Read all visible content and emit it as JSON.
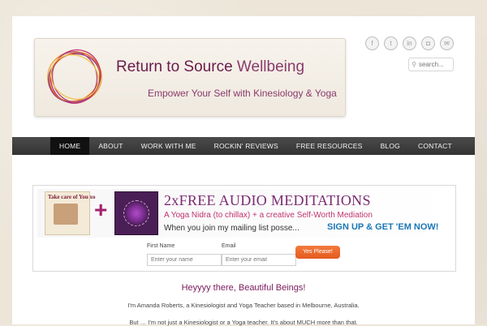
{
  "header": {
    "title_bold": "Return to Source",
    "title_light": "Wellbeing",
    "tagline": "Empower Your Self with Kinesiology & Yoga"
  },
  "social": {
    "icons": [
      {
        "name": "facebook-icon",
        "glyph": "f"
      },
      {
        "name": "twitter-icon",
        "glyph": "t"
      },
      {
        "name": "linkedin-icon",
        "glyph": "in"
      },
      {
        "name": "instagram-icon",
        "glyph": "◘"
      },
      {
        "name": "email-icon",
        "glyph": "✉"
      }
    ]
  },
  "search": {
    "placeholder": "search..."
  },
  "nav": {
    "items": [
      {
        "label": "HOME",
        "active": true
      },
      {
        "label": "ABOUT"
      },
      {
        "label": "WORK WITH ME"
      },
      {
        "label": "ROCKIN' REVIEWS"
      },
      {
        "label": "FREE RESOURCES"
      },
      {
        "label": "BLOG"
      },
      {
        "label": "CONTACT"
      }
    ]
  },
  "optin": {
    "thumb1_text": "Take care of You xo",
    "headline": "2xFREE AUDIO MEDITATIONS",
    "subline": "A Yoga Nidra (to chillax) + a creative Self-Worth Mediation",
    "line": "When you join my mailing list posse...",
    "cta": "SIGN UP & GET 'EM NOW!",
    "first_name_label": "First Name",
    "first_name_placeholder": "Enter your name",
    "email_label": "Email",
    "email_placeholder": "Enter your email",
    "button_label": "Yes Please!"
  },
  "content": {
    "greeting": "Heyyyy there, Beautiful Beings!",
    "intro": "I'm Amanda Roberts, a Kinesiologist and Yoga Teacher based in Melbourne, Australia.",
    "intro2": "But … I'm not just a Kinesiologist or a Yoga teacher. It's about MUCH more than that."
  }
}
